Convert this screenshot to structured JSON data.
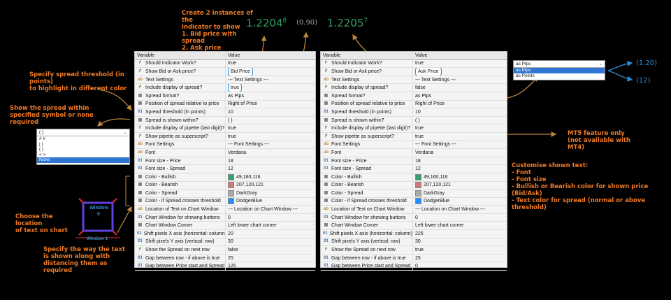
{
  "annotations": {
    "create_instances": "Create 2 instances of the\nindicator to show\n1. Bid price with spread\n2. Ask price",
    "spread_threshold": "Specify spread threshold (in points)\nto highlight in different color",
    "spread_within": "Show the spread within\nspecified symbol or none required",
    "choose_location": "Choose the location\nof text on chart",
    "specify_way": "Specify the way the text\nis shown along with\ndistancing them as required",
    "mt5_only": "MT5 feature only\n(not available with MT4)",
    "customise": "Customise shown text:\n- Font\n- Font size\n- Bullish or Bearish color for shown price (Bid/Ask)\n- Text color for spread (normal or above threshold)",
    "pips_result": "(1.20)",
    "points_result": "(12)"
  },
  "prices": {
    "bid_main": "1.2204",
    "bid_sup": "8",
    "spread": "(0.90)",
    "ask_main": "1.2205",
    "ask_sup": "7"
  },
  "window_diagram": {
    "window_label": "Window\n0",
    "window_bottom": "Window 1"
  },
  "dropdown_within": {
    "selected": "( )",
    "options": [
      "# #",
      "| |",
      "( )",
      "< >",
      "None"
    ],
    "active": "None"
  },
  "dropdown_format": {
    "selected": "as Pips",
    "options": [
      "as Pips",
      "as Points"
    ],
    "active": "as Pips"
  },
  "table_headers": {
    "variable": "Variable",
    "value": "Value"
  },
  "colors": {
    "bullish": "#31a074",
    "bearish": "#cf7879",
    "darkgray": "#a9a9a9",
    "dodgerblue": "#1e90ff",
    "annotation": "#f07a22"
  },
  "table_left": [
    {
      "icon": "bool",
      "name": "Should Indicator Work?",
      "value": "true"
    },
    {
      "icon": "bool",
      "name": "Show Bid or Ask price?",
      "value": "Bid Price",
      "hl": true
    },
    {
      "icon": "str",
      "name": "Text Settings",
      "value": "--- Text Settings ---"
    },
    {
      "icon": "bool",
      "name": "Include display of spread?",
      "value": "true",
      "hl": true
    },
    {
      "icon": "enum",
      "name": "Spread format?",
      "value": "as Pips"
    },
    {
      "icon": "enum",
      "name": "Position of spread relative to price",
      "value": "Right of Price"
    },
    {
      "icon": "num",
      "name": "Spread threshold (in points)",
      "value": "10"
    },
    {
      "icon": "enum",
      "name": "Spread is shown within?",
      "value": "( )"
    },
    {
      "icon": "bool",
      "name": "Include display of pipette (last digit)?",
      "value": "true"
    },
    {
      "icon": "bool",
      "name": "Show pipette as superscript?",
      "value": "true"
    },
    {
      "icon": "str",
      "name": "Font Settings",
      "value": "--- Font Settings ---"
    },
    {
      "icon": "str",
      "name": "Font",
      "value": "Verdana"
    },
    {
      "icon": "num",
      "name": "Font size - Price",
      "value": "18"
    },
    {
      "icon": "num",
      "name": "Font size - Spread",
      "value": "12"
    },
    {
      "icon": "enum",
      "name": "Color - Bullish",
      "value": "49,160,116",
      "swatch": "bullish"
    },
    {
      "icon": "enum",
      "name": "Color - Bearish",
      "value": "207,120,121",
      "swatch": "bearish"
    },
    {
      "icon": "enum",
      "name": "Color - Spread",
      "value": "DarkGray",
      "swatch": "darkgray"
    },
    {
      "icon": "enum",
      "name": "Color - if Spread crosses threshold",
      "value": "DodgerBlue",
      "swatch": "dodgerblue"
    },
    {
      "icon": "str",
      "name": "Location of Text on Chart Window",
      "value": "--- Location on Chart Window ---"
    },
    {
      "icon": "num",
      "name": "Chart Window for showing buttons",
      "value": "0"
    },
    {
      "icon": "enum",
      "name": "Chart Window Corner",
      "value": "Left lower chart corner"
    },
    {
      "icon": "num",
      "name": "Shift pixels X axis (horizontal: column)",
      "value": "20"
    },
    {
      "icon": "num",
      "name": "Shift pixels Y axis (vertical: row)",
      "value": "30"
    },
    {
      "icon": "bool",
      "name": "Show the Spread on next row",
      "value": "false"
    },
    {
      "icon": "num",
      "name": "Gap between row - if above is true",
      "value": "25"
    },
    {
      "icon": "num",
      "name": "Gap between Price start and Spread",
      "value": "125"
    }
  ],
  "table_right": [
    {
      "icon": "bool",
      "name": "Should Indicator Work?",
      "value": "true"
    },
    {
      "icon": "bool",
      "name": "Show Bid or Ask price?",
      "value": "Ask Price",
      "hl": true
    },
    {
      "icon": "str",
      "name": "Text Settings",
      "value": "--- Text Settings ---"
    },
    {
      "icon": "bool",
      "name": "Include display of spread?",
      "value": "false"
    },
    {
      "icon": "enum",
      "name": "Spread format?",
      "value": "as Pips"
    },
    {
      "icon": "enum",
      "name": "Position of spread relative to price",
      "value": "Right of Price"
    },
    {
      "icon": "num",
      "name": "Spread threshold (in points)",
      "value": "10"
    },
    {
      "icon": "enum",
      "name": "Spread is shown within?",
      "value": "( )"
    },
    {
      "icon": "bool",
      "name": "Include display of pipette (last digit)?",
      "value": "true"
    },
    {
      "icon": "bool",
      "name": "Show pipette as superscript?",
      "value": "true"
    },
    {
      "icon": "str",
      "name": "Font Settings",
      "value": "--- Font Settings ---"
    },
    {
      "icon": "str",
      "name": "Font",
      "value": "Verdana"
    },
    {
      "icon": "num",
      "name": "Font size - Price",
      "value": "18"
    },
    {
      "icon": "num",
      "name": "Font size - Spread",
      "value": "12"
    },
    {
      "icon": "enum",
      "name": "Color - Bullish",
      "value": "49,160,116",
      "swatch": "bullish"
    },
    {
      "icon": "enum",
      "name": "Color - Bearish",
      "value": "207,120,121",
      "swatch": "bearish"
    },
    {
      "icon": "enum",
      "name": "Color - Spread",
      "value": "DarkGray",
      "swatch": "darkgray"
    },
    {
      "icon": "enum",
      "name": "Color - if Spread crosses threshold",
      "value": "DodgerBlue",
      "swatch": "dodgerblue"
    },
    {
      "icon": "str",
      "name": "Location of Text on Chart Window",
      "value": "--- Location on Chart Window ---"
    },
    {
      "icon": "num",
      "name": "Chart Window for showing buttons",
      "value": "0"
    },
    {
      "icon": "enum",
      "name": "Chart Window Corner",
      "value": "Left lower chart corner"
    },
    {
      "icon": "num",
      "name": "Shift pixels X axis (horizontal: column)",
      "value": "225"
    },
    {
      "icon": "num",
      "name": "Shift pixels Y axis (vertical: row)",
      "value": "30"
    },
    {
      "icon": "bool",
      "name": "Show the Spread on next row",
      "value": "true"
    },
    {
      "icon": "num",
      "name": "Gap between row - if above is true",
      "value": "25"
    },
    {
      "icon": "num",
      "name": "Gap between Price start and Spread",
      "value": "0"
    }
  ]
}
